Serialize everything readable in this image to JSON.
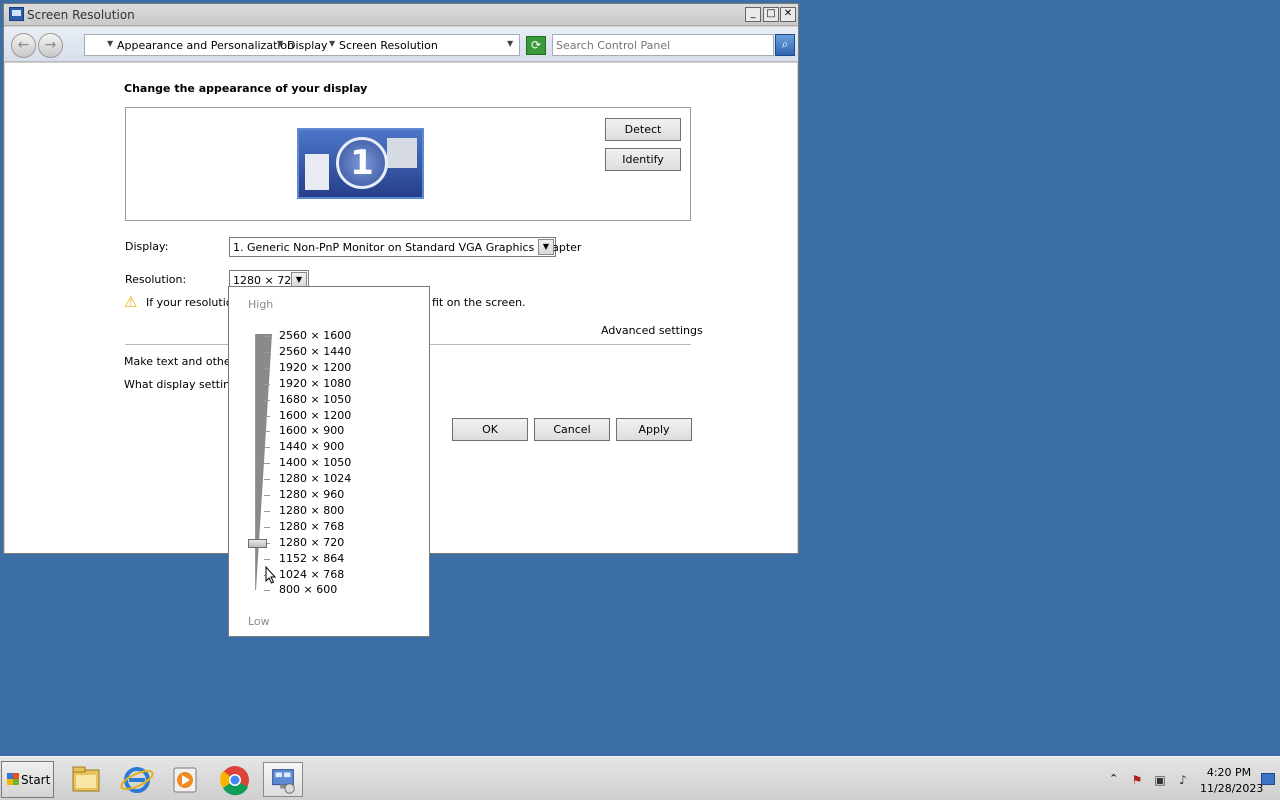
{
  "window": {
    "title": "Screen Resolution",
    "controls": {
      "minimize": "_",
      "maximize": "□",
      "close": "✕"
    }
  },
  "addressbar": {
    "breadcrumbs": [
      "Appearance and Personalization",
      "Display",
      "Screen Resolution"
    ],
    "search_placeholder": "Search Control Panel"
  },
  "main": {
    "heading": "Change the appearance of your display",
    "monitor_number": "1",
    "detect_label": "Detect",
    "identify_label": "Identify",
    "display_label": "Display:",
    "display_value": "1. Generic Non-PnP Monitor on Standard VGA Graphics Adapter",
    "resolution_label": "Resolution:",
    "resolution_value": "1280 × 720",
    "warning_text_a": "If your resolution",
    "warning_text_b": "fit on the screen.",
    "advanced_settings": "Advanced settings",
    "link_make_text": "Make text and other it",
    "link_what_settings": "What display settings",
    "ok_label": "OK",
    "cancel_label": "Cancel",
    "apply_label": "Apply"
  },
  "resolution_popup": {
    "high_label": "High",
    "low_label": "Low",
    "options": [
      "2560 × 1600",
      "2560 × 1440",
      "1920 × 1200",
      "1920 × 1080",
      "1680 × 1050",
      "1600 × 1200",
      "1600 × 900",
      "1440 × 900",
      "1400 × 1050",
      "1280 × 1024",
      "1280 × 960",
      "1280 × 800",
      "1280 × 768",
      "1280 × 720",
      "1152 × 864",
      "1024 × 768",
      "800 × 600"
    ],
    "selected": "1280 × 720"
  },
  "taskbar": {
    "start_label": "Start",
    "apps": [
      "explorer-icon",
      "internet-explorer-icon",
      "media-player-icon",
      "chrome-icon",
      "control-panel-icon"
    ],
    "clock_time": "4:20 PM",
    "clock_date": "11/28/2023"
  }
}
